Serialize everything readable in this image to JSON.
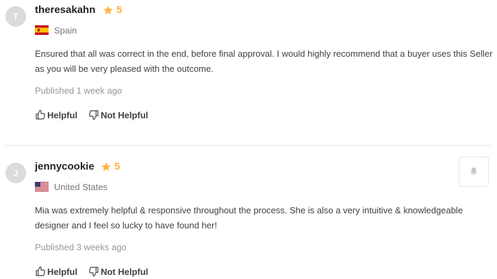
{
  "reviews": [
    {
      "avatar_letter": "T",
      "username": "theresakahn",
      "rating": "5",
      "country": "Spain",
      "flag_icon": "spain-flag-icon",
      "text": "Ensured that all was correct in the end, before final approval. I would highly recommend that a buyer uses this Seller as you will be very pleased with the outcome.",
      "published": "Published 1 week ago",
      "helpful_label": "Helpful",
      "not_helpful_label": "Not Helpful"
    },
    {
      "avatar_letter": "J",
      "username": "jennycookie",
      "rating": "5",
      "country": "United States",
      "flag_icon": "us-flag-icon",
      "text": "Mia was extremely helpful & responsive throughout the process. She is also a very intuitive & knowledgeable designer and I feel so lucky to have found her!",
      "published": "Published 3 weeks ago",
      "helpful_label": "Helpful",
      "not_helpful_label": "Not Helpful"
    }
  ],
  "colors": {
    "star": "#ffb33e",
    "avatar_bg": "#dadbdd",
    "divider": "#e4e5e7",
    "muted_text": "#95979d"
  },
  "icons": {
    "star": "star-icon",
    "thumbs_up": "thumbs-up-icon",
    "thumbs_down": "thumbs-down-icon",
    "side_button": "bell-icon"
  }
}
